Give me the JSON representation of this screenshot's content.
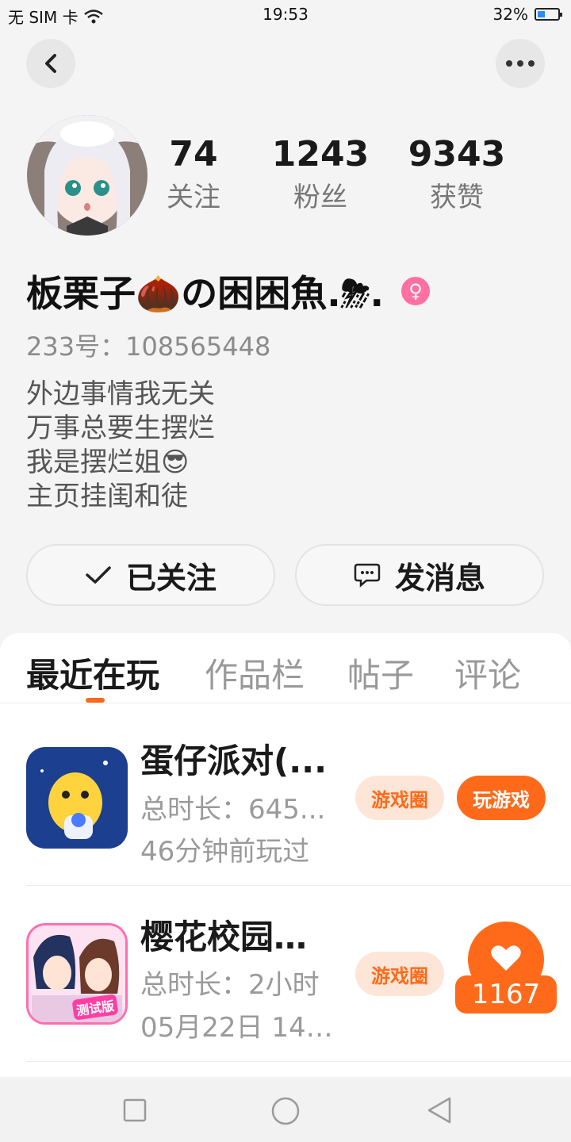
{
  "status_bar": {
    "carrier": "无 SIM 卡",
    "time": "19:53",
    "battery_percent": "32%"
  },
  "profile": {
    "name": "板栗子🌰の困困魚.⛈.",
    "gender_symbol": "♀",
    "id_text": "233号：108565448",
    "bio": [
      "外边事情我无关",
      "万事总要生摆烂",
      "我是摆烂姐😎",
      "主页挂闺和徒"
    ],
    "stats": [
      {
        "value": "74",
        "label": "关注"
      },
      {
        "value": "1243",
        "label": "粉丝"
      },
      {
        "value": "9343",
        "label": "获赞"
      }
    ]
  },
  "actions": {
    "follow_label": "已关注",
    "message_label": "发消息"
  },
  "tabs": [
    {
      "label": "最近在玩",
      "active": true
    },
    {
      "label": "作品栏",
      "active": false
    },
    {
      "label": "帖子",
      "active": false
    },
    {
      "label": "评论",
      "active": false
    }
  ],
  "games": [
    {
      "title": "蛋仔派对(...",
      "duration": "总时长：645...",
      "last_played": "46分钟前玩过",
      "circle_label": "游戏圈",
      "play_label": "玩游戏"
    },
    {
      "title": "樱花校园模...",
      "duration": "总时长：2小时",
      "last_played": "05月22日 14:...",
      "circle_label": "游戏圈",
      "icon_badge": "测试版"
    }
  ],
  "like_widget": {
    "count": "1167"
  },
  "icons": {
    "back": "back-icon",
    "more": "more-icon",
    "check": "check-icon",
    "message": "message-icon",
    "heart": "heart-icon",
    "nav": [
      "square-icon",
      "circle-icon",
      "triangle-back-icon"
    ]
  },
  "colors": {
    "accent": "#ff6a1a",
    "accent_light": "#fde6d8",
    "gender": "#ff6f9f"
  }
}
